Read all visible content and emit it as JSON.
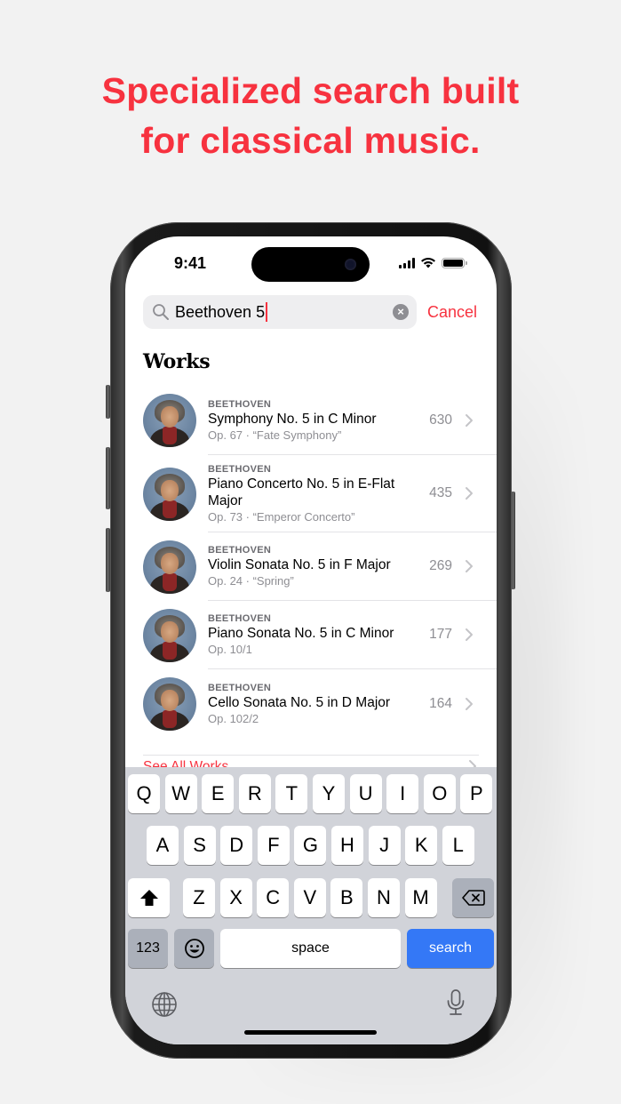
{
  "headline": {
    "line1": "Specialized search built",
    "line2": "for classical music."
  },
  "colors": {
    "accent": "#f7323f",
    "search_key": "#3478f6",
    "keyboard_bg": "#d1d3d9"
  },
  "status_bar": {
    "time": "9:41",
    "icons": [
      "cellular-signal-icon",
      "wifi-icon",
      "battery-icon"
    ]
  },
  "search": {
    "icon": "magnifying-glass-icon",
    "query": "Beethoven 5",
    "clear_icon": "clear-x-icon",
    "cancel_label": "Cancel"
  },
  "works": {
    "title": "Works",
    "items": [
      {
        "composer": "BEETHOVEN",
        "title": "Symphony No. 5 in C Minor",
        "subtitle": "Op. 67 · “Fate Symphony”",
        "count": "630"
      },
      {
        "composer": "BEETHOVEN",
        "title": "Piano Concerto No. 5 in E-Flat Major",
        "subtitle": "Op. 73 · “Emperor Concerto”",
        "count": "435"
      },
      {
        "composer": "BEETHOVEN",
        "title": "Violin Sonata No. 5 in F Major",
        "subtitle": "Op. 24 · “Spring”",
        "count": "269"
      },
      {
        "composer": "BEETHOVEN",
        "title": "Piano Sonata No. 5 in C Minor",
        "subtitle": "Op. 10/1",
        "count": "177"
      },
      {
        "composer": "BEETHOVEN",
        "title": "Cello Sonata No. 5 in D Major",
        "subtitle": "Op. 102/2",
        "count": "164"
      }
    ],
    "see_all_label": "See All Works"
  },
  "keyboard": {
    "row1": [
      "Q",
      "W",
      "E",
      "R",
      "T",
      "Y",
      "U",
      "I",
      "O",
      "P"
    ],
    "row2": [
      "A",
      "S",
      "D",
      "F",
      "G",
      "H",
      "J",
      "K",
      "L"
    ],
    "row3": [
      "Z",
      "X",
      "C",
      "V",
      "B",
      "N",
      "M"
    ],
    "shift_icon": "shift-arrow-icon",
    "delete_icon": "backspace-icon",
    "numbers_label": "123",
    "emoji_icon": "emoji-smiley-icon",
    "space_label": "space",
    "search_label": "search",
    "globe_icon": "globe-icon",
    "mic_icon": "microphone-icon"
  }
}
